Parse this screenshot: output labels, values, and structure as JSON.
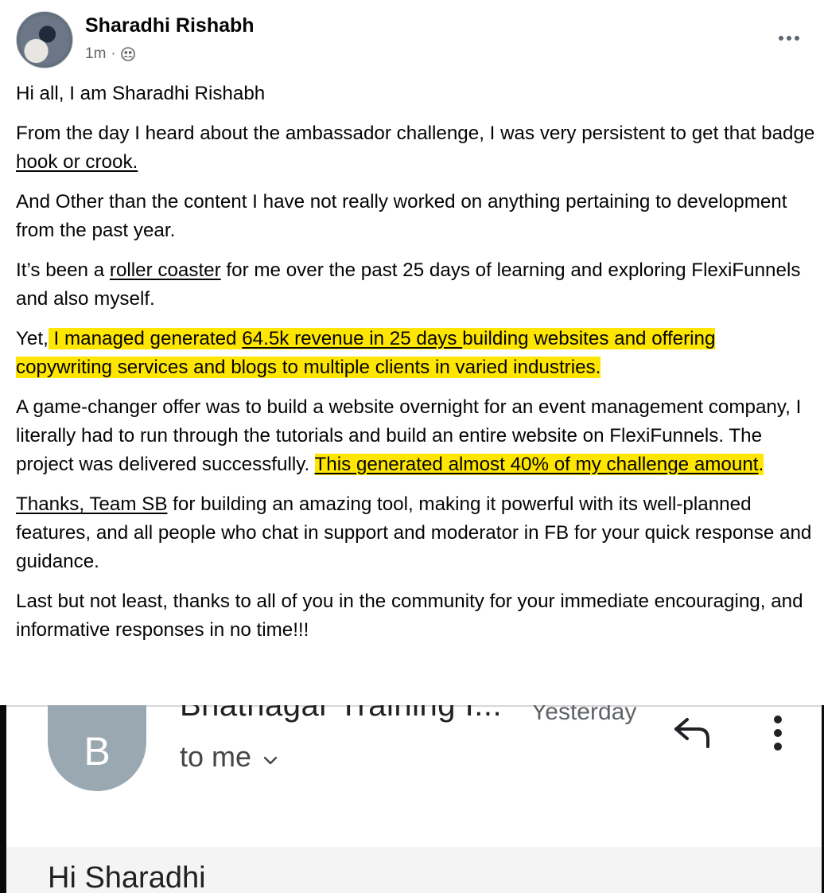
{
  "post": {
    "author": "Sharadhi Rishabh",
    "time": "1m",
    "separator": "·",
    "audience_icon": "group-icon",
    "more_icon": "more-options-icon",
    "paragraphs": {
      "p1": "Hi all, I am Sharadhi Rishabh",
      "p2_a": "From the day I heard about the ambassador challenge, I was very persistent to get that badge ",
      "p2_link": "hook or crook.",
      "p3": "And Other than the content I have not really worked on anything pertaining to development from the past year.",
      "p4_a": "It’s been a ",
      "p4_link": "roller coaster",
      "p4_b": " for me over the past 25 days of learning and exploring FlexiFunnels and also myself.",
      "p5_a": "Yet,",
      "p5_hl_a": " I managed generated ",
      "p5_hl_link": "64.5k revenue in 25 days ",
      "p5_hl_b": "building websites and offering copywriting services and blogs to multiple clients in varied industries.",
      "p6_a": "A game-changer offer was to build a website overnight for an event management company, I literally had to run through the tutorials and build an entire website on FlexiFunnels. The project was delivered successfully. ",
      "p6_hl_link": "This generated almost 40% of my challenge amount",
      "p6_hl_end": ".  ",
      "p7_link": "Thanks, Team SB",
      "p7_b": " for building an amazing tool, making it powerful with its well-planned features, and all people who chat in support and moderator in FB for your quick response and guidance.",
      "p8": "Last but not least, thanks to all of you in the community for your immediate encouraging, and informative responses in no time!!!"
    },
    "highlight_color": "#ffe600"
  },
  "email": {
    "avatar_letter": "B",
    "avatar_color": "#9aa8b1",
    "sender": "Bhatnagar Training I...",
    "time": "Yesterday",
    "to": "to me",
    "reply_icon": "reply-icon",
    "more_icon": "kebab-menu-icon",
    "greeting": "Hi Sharadhi"
  }
}
